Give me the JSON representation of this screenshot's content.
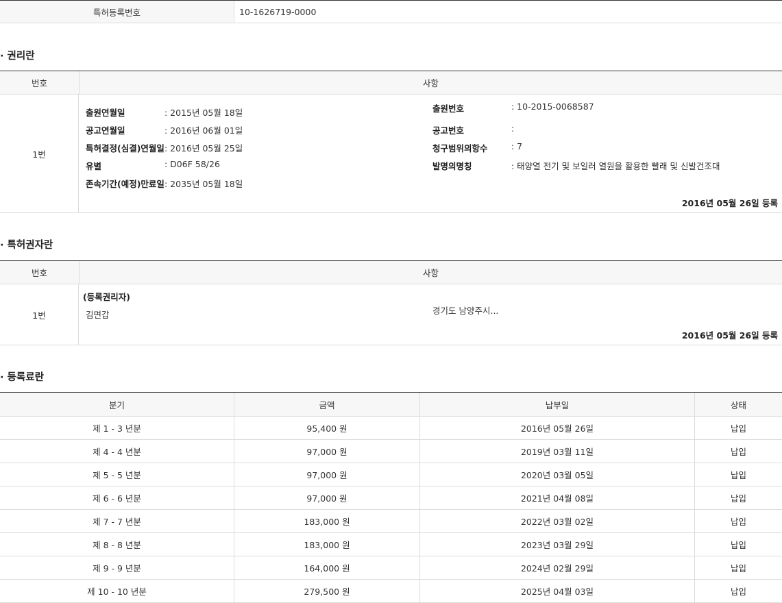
{
  "registration": {
    "label": "특허등록번호",
    "value": "10-1626719-0000"
  },
  "rights_section": {
    "title": "· 권리란",
    "header_no": "번호",
    "header_detail": "사항",
    "row": {
      "no": "1번",
      "left": [
        {
          "label": "출원연월일",
          "value": ": 2015년 05월 18일"
        },
        {
          "label": "공고연월일",
          "value": ": 2016년 06월 01일"
        },
        {
          "label": "특허결정(심결)연월일",
          "value": ": 2016년 05월 25일"
        },
        {
          "label": "유별",
          "value": ": D06F 58/26"
        },
        {
          "label": "존속기간(예정)만료일",
          "value": ": 2035년 05월 18일"
        }
      ],
      "right": [
        {
          "label": "출원번호",
          "value": ": 10-2015-0068587"
        },
        {
          "label": "공고번호",
          "value": ":"
        },
        {
          "label": "청구범위의항수",
          "value": ": 7"
        },
        {
          "label": "발명의명칭",
          "value": ": 태양열 전기 및 보일러 열원을 활용한 빨래 및 신발건조대"
        }
      ],
      "stamp": "2016년 05월 26일 등록"
    }
  },
  "holder_section": {
    "title": "· 특허권자란",
    "header_no": "번호",
    "header_detail": "사항",
    "row": {
      "no": "1번",
      "role": "(등록권리자)",
      "name": "김면갑",
      "address": "경기도 남양주시...",
      "stamp": "2016년 05월 26일 등록"
    }
  },
  "fee_section": {
    "title": "· 등록료란",
    "headers": [
      "분기",
      "금액",
      "납부일",
      "상태"
    ],
    "rows": [
      {
        "period": "제 1 - 3 년분",
        "amount": "95,400 원",
        "date": "2016년 05월 26일",
        "status": "납입"
      },
      {
        "period": "제 4 - 4 년분",
        "amount": "97,000 원",
        "date": "2019년 03월 11일",
        "status": "납입"
      },
      {
        "period": "제 5 - 5 년분",
        "amount": "97,000 원",
        "date": "2020년 03월 05일",
        "status": "납입"
      },
      {
        "period": "제 6 - 6 년분",
        "amount": "97,000 원",
        "date": "2021년 04월 08일",
        "status": "납입"
      },
      {
        "period": "제 7 - 7 년분",
        "amount": "183,000 원",
        "date": "2022년 03월 02일",
        "status": "납입"
      },
      {
        "period": "제 8 - 8 년분",
        "amount": "183,000 원",
        "date": "2023년 03월 29일",
        "status": "납입"
      },
      {
        "period": "제 9 - 9 년분",
        "amount": "164,000 원",
        "date": "2024년 02월 29일",
        "status": "납입"
      },
      {
        "period": "제 10 - 10 년분",
        "amount": "279,500 원",
        "date": "2025년 04월 03일",
        "status": "납입"
      }
    ]
  }
}
